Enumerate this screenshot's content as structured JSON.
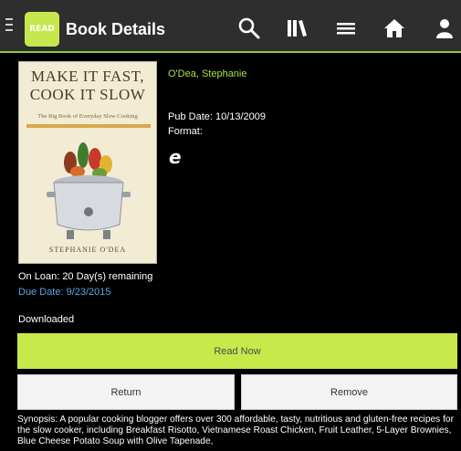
{
  "header": {
    "title": "Book Details",
    "logo_text": "READ",
    "icons": [
      "menu-drawer-icon",
      "search-icon",
      "library-icon",
      "menu-list-icon",
      "home-icon",
      "account-icon"
    ]
  },
  "book": {
    "cover": {
      "title_line1": "MAKE IT FAST,",
      "title_line2": "COOK IT SLOW",
      "subtitle": "The Big Book of Everyday Slow Cooking",
      "author": "STEPHANIE O'DEA"
    },
    "author": "O'Dea, Stephanie",
    "pub_date": "Pub Date: 10/13/2009",
    "format_label": "Format:",
    "format_icon": "e",
    "loan_status": "On Loan: 20 Day(s) remaining",
    "due_date": "Due Date: 9/23/2015",
    "download_status": "Downloaded"
  },
  "actions": {
    "read_now": "Read Now",
    "return": "Return",
    "remove": "Remove"
  },
  "synopsis": "Synopsis: A popular cooking blogger offers over 300 affordable, tasty, nutritious and gluten-free recipes for the slow cooker, including Breakfast Risotto, Vietnamese Roast Chicken, Fruit Leather, 5-Layer Brownies, Blue Cheese Potato Soup with Olive Tapenade,",
  "colors": {
    "accent": "#c8e94a",
    "author_link": "#a8e04d",
    "due_date": "#5aa6e6",
    "topbar": "#2e2e2e"
  }
}
